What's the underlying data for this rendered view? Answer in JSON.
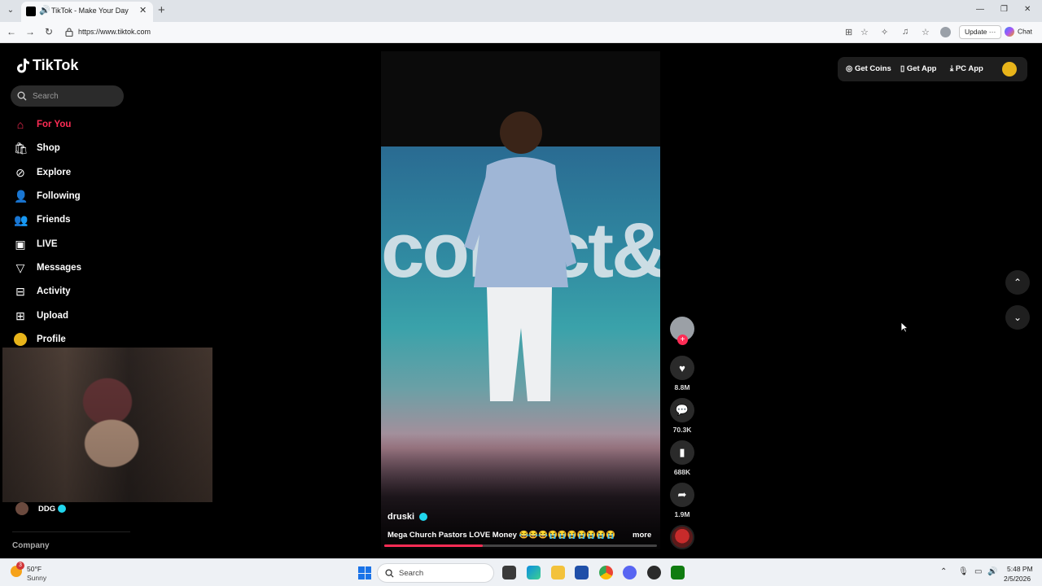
{
  "browser": {
    "tab_title": "TikTok - Make Your Day",
    "url": "https://www.tiktok.com",
    "update_label": "Update",
    "update_more": "···",
    "chat_label": "Chat"
  },
  "sidebar": {
    "logo_text": "TikTok",
    "search_placeholder": "Search",
    "items": [
      {
        "label": "For You",
        "icon": "home-icon"
      },
      {
        "label": "Shop",
        "icon": "shop-icon"
      },
      {
        "label": "Explore",
        "icon": "compass-icon"
      },
      {
        "label": "Following",
        "icon": "following-icon"
      },
      {
        "label": "Friends",
        "icon": "friends-icon"
      },
      {
        "label": "LIVE",
        "icon": "live-icon"
      },
      {
        "label": "Messages",
        "icon": "messages-icon"
      },
      {
        "label": "Activity",
        "icon": "activity-icon"
      },
      {
        "label": "Upload",
        "icon": "upload-icon"
      },
      {
        "label": "Profile",
        "icon": "avatar"
      }
    ],
    "following_account": "DDG",
    "company_label": "Company"
  },
  "top_actions": {
    "get_coins": "Get Coins",
    "get_app": "Get App",
    "pc_app": "PC App"
  },
  "video": {
    "overlay_text": "collect&bra",
    "author": "druski",
    "caption": "Mega Church Pastors LOVE Money 😂😂😂😭😭😭😭😭😭😭",
    "more": "more",
    "progress": 0.36
  },
  "actions": {
    "likes": "8.8M",
    "comments": "70.3K",
    "saves": "688K",
    "shares": "1.9M"
  },
  "taskbar": {
    "weather_badge": "3",
    "temperature": "50°F",
    "condition": "Sunny",
    "search_placeholder": "Search",
    "time": "5:48 PM",
    "date": "2/5/2026"
  },
  "colors": {
    "accent": "#fe2c55",
    "verified": "#20d5ec"
  }
}
